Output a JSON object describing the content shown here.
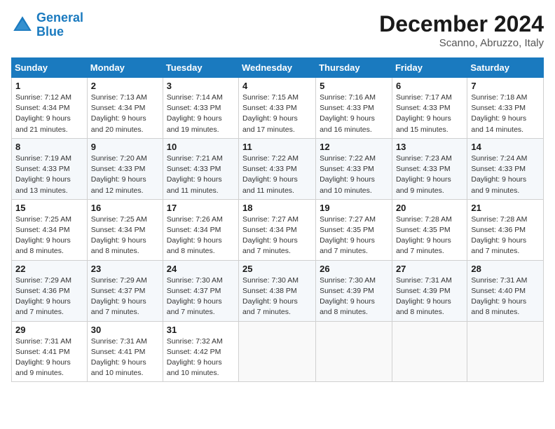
{
  "header": {
    "logo_line1": "General",
    "logo_line2": "Blue",
    "month_title": "December 2024",
    "location": "Scanno, Abruzzo, Italy"
  },
  "days_of_week": [
    "Sunday",
    "Monday",
    "Tuesday",
    "Wednesday",
    "Thursday",
    "Friday",
    "Saturday"
  ],
  "weeks": [
    [
      {
        "day": "1",
        "sunrise": "Sunrise: 7:12 AM",
        "sunset": "Sunset: 4:34 PM",
        "daylight": "Daylight: 9 hours and 21 minutes."
      },
      {
        "day": "2",
        "sunrise": "Sunrise: 7:13 AM",
        "sunset": "Sunset: 4:34 PM",
        "daylight": "Daylight: 9 hours and 20 minutes."
      },
      {
        "day": "3",
        "sunrise": "Sunrise: 7:14 AM",
        "sunset": "Sunset: 4:33 PM",
        "daylight": "Daylight: 9 hours and 19 minutes."
      },
      {
        "day": "4",
        "sunrise": "Sunrise: 7:15 AM",
        "sunset": "Sunset: 4:33 PM",
        "daylight": "Daylight: 9 hours and 17 minutes."
      },
      {
        "day": "5",
        "sunrise": "Sunrise: 7:16 AM",
        "sunset": "Sunset: 4:33 PM",
        "daylight": "Daylight: 9 hours and 16 minutes."
      },
      {
        "day": "6",
        "sunrise": "Sunrise: 7:17 AM",
        "sunset": "Sunset: 4:33 PM",
        "daylight": "Daylight: 9 hours and 15 minutes."
      },
      {
        "day": "7",
        "sunrise": "Sunrise: 7:18 AM",
        "sunset": "Sunset: 4:33 PM",
        "daylight": "Daylight: 9 hours and 14 minutes."
      }
    ],
    [
      {
        "day": "8",
        "sunrise": "Sunrise: 7:19 AM",
        "sunset": "Sunset: 4:33 PM",
        "daylight": "Daylight: 9 hours and 13 minutes."
      },
      {
        "day": "9",
        "sunrise": "Sunrise: 7:20 AM",
        "sunset": "Sunset: 4:33 PM",
        "daylight": "Daylight: 9 hours and 12 minutes."
      },
      {
        "day": "10",
        "sunrise": "Sunrise: 7:21 AM",
        "sunset": "Sunset: 4:33 PM",
        "daylight": "Daylight: 9 hours and 11 minutes."
      },
      {
        "day": "11",
        "sunrise": "Sunrise: 7:22 AM",
        "sunset": "Sunset: 4:33 PM",
        "daylight": "Daylight: 9 hours and 11 minutes."
      },
      {
        "day": "12",
        "sunrise": "Sunrise: 7:22 AM",
        "sunset": "Sunset: 4:33 PM",
        "daylight": "Daylight: 9 hours and 10 minutes."
      },
      {
        "day": "13",
        "sunrise": "Sunrise: 7:23 AM",
        "sunset": "Sunset: 4:33 PM",
        "daylight": "Daylight: 9 hours and 9 minutes."
      },
      {
        "day": "14",
        "sunrise": "Sunrise: 7:24 AM",
        "sunset": "Sunset: 4:33 PM",
        "daylight": "Daylight: 9 hours and 9 minutes."
      }
    ],
    [
      {
        "day": "15",
        "sunrise": "Sunrise: 7:25 AM",
        "sunset": "Sunset: 4:34 PM",
        "daylight": "Daylight: 9 hours and 8 minutes."
      },
      {
        "day": "16",
        "sunrise": "Sunrise: 7:25 AM",
        "sunset": "Sunset: 4:34 PM",
        "daylight": "Daylight: 9 hours and 8 minutes."
      },
      {
        "day": "17",
        "sunrise": "Sunrise: 7:26 AM",
        "sunset": "Sunset: 4:34 PM",
        "daylight": "Daylight: 9 hours and 8 minutes."
      },
      {
        "day": "18",
        "sunrise": "Sunrise: 7:27 AM",
        "sunset": "Sunset: 4:34 PM",
        "daylight": "Daylight: 9 hours and 7 minutes."
      },
      {
        "day": "19",
        "sunrise": "Sunrise: 7:27 AM",
        "sunset": "Sunset: 4:35 PM",
        "daylight": "Daylight: 9 hours and 7 minutes."
      },
      {
        "day": "20",
        "sunrise": "Sunrise: 7:28 AM",
        "sunset": "Sunset: 4:35 PM",
        "daylight": "Daylight: 9 hours and 7 minutes."
      },
      {
        "day": "21",
        "sunrise": "Sunrise: 7:28 AM",
        "sunset": "Sunset: 4:36 PM",
        "daylight": "Daylight: 9 hours and 7 minutes."
      }
    ],
    [
      {
        "day": "22",
        "sunrise": "Sunrise: 7:29 AM",
        "sunset": "Sunset: 4:36 PM",
        "daylight": "Daylight: 9 hours and 7 minutes."
      },
      {
        "day": "23",
        "sunrise": "Sunrise: 7:29 AM",
        "sunset": "Sunset: 4:37 PM",
        "daylight": "Daylight: 9 hours and 7 minutes."
      },
      {
        "day": "24",
        "sunrise": "Sunrise: 7:30 AM",
        "sunset": "Sunset: 4:37 PM",
        "daylight": "Daylight: 9 hours and 7 minutes."
      },
      {
        "day": "25",
        "sunrise": "Sunrise: 7:30 AM",
        "sunset": "Sunset: 4:38 PM",
        "daylight": "Daylight: 9 hours and 7 minutes."
      },
      {
        "day": "26",
        "sunrise": "Sunrise: 7:30 AM",
        "sunset": "Sunset: 4:39 PM",
        "daylight": "Daylight: 9 hours and 8 minutes."
      },
      {
        "day": "27",
        "sunrise": "Sunrise: 7:31 AM",
        "sunset": "Sunset: 4:39 PM",
        "daylight": "Daylight: 9 hours and 8 minutes."
      },
      {
        "day": "28",
        "sunrise": "Sunrise: 7:31 AM",
        "sunset": "Sunset: 4:40 PM",
        "daylight": "Daylight: 9 hours and 8 minutes."
      }
    ],
    [
      {
        "day": "29",
        "sunrise": "Sunrise: 7:31 AM",
        "sunset": "Sunset: 4:41 PM",
        "daylight": "Daylight: 9 hours and 9 minutes."
      },
      {
        "day": "30",
        "sunrise": "Sunrise: 7:31 AM",
        "sunset": "Sunset: 4:41 PM",
        "daylight": "Daylight: 9 hours and 10 minutes."
      },
      {
        "day": "31",
        "sunrise": "Sunrise: 7:32 AM",
        "sunset": "Sunset: 4:42 PM",
        "daylight": "Daylight: 9 hours and 10 minutes."
      },
      null,
      null,
      null,
      null
    ]
  ]
}
